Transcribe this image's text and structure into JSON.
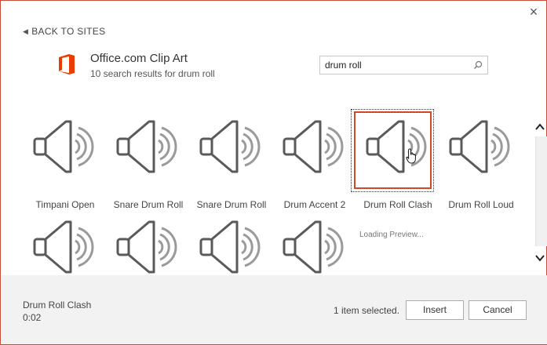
{
  "dialog": {
    "close_label": "×",
    "back_label": "BACK TO SITES"
  },
  "header": {
    "title": "Office.com Clip Art",
    "subtitle": "10 search results for drum roll",
    "logo_color": "#eb3c00"
  },
  "search": {
    "value": "drum roll",
    "icon": "search-icon"
  },
  "results": {
    "items": [
      {
        "label": "Timpani Open"
      },
      {
        "label": "Snare Drum Roll"
      },
      {
        "label": "Snare Drum Roll"
      },
      {
        "label": "Drum Accent 2"
      },
      {
        "label": "Drum Roll Clash",
        "selected": true
      },
      {
        "label": "Drum Roll Loud"
      },
      {
        "label": ""
      },
      {
        "label": ""
      },
      {
        "label": ""
      },
      {
        "label": ""
      }
    ],
    "loading_text": "Loading Preview..."
  },
  "footer": {
    "selected_name": "Drum Roll Clash",
    "duration": "0:02",
    "status": "1 item selected.",
    "insert_label": "Insert",
    "cancel_label": "Cancel"
  },
  "colors": {
    "accent": "#d24726",
    "icon_stroke": "#5a5a5a",
    "icon_waves": "#9a9a9a"
  }
}
